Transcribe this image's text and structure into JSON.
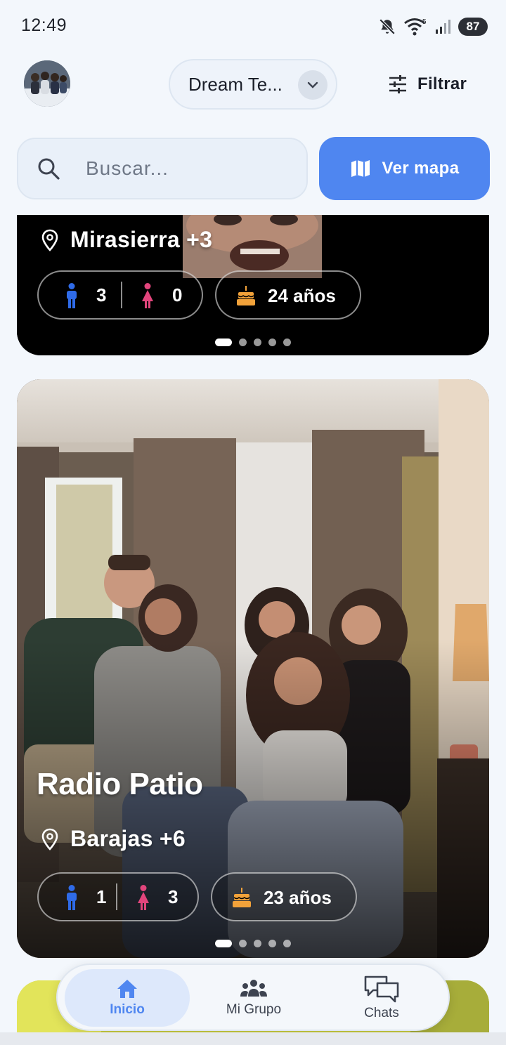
{
  "status": {
    "time": "12:49",
    "battery": "87",
    "network_tag": "5"
  },
  "header": {
    "group_name": "Dream Te...",
    "filter_label": "Filtrar"
  },
  "search": {
    "placeholder": "Buscar...",
    "map_button": "Ver mapa"
  },
  "colors": {
    "accent": "#4f86f0",
    "male_icon": "#2f6be8",
    "female_icon": "#e2457c",
    "cake_icon": "#f2a23a"
  },
  "cards": [
    {
      "location": "Mirasierra +3",
      "male_count": "3",
      "female_count": "0",
      "age": "24 años",
      "pages": 5,
      "active_page": 1
    },
    {
      "name": "Radio Patio",
      "location": "Barajas +6",
      "male_count": "1",
      "female_count": "3",
      "age": "23 años",
      "pages": 5,
      "active_page": 1
    }
  ],
  "nav": {
    "items": [
      {
        "label": "Inicio",
        "icon": "home-icon",
        "active": true
      },
      {
        "label": "Mi Grupo",
        "icon": "group-icon",
        "active": false
      },
      {
        "label": "Chats",
        "icon": "chats-icon",
        "active": false
      }
    ]
  }
}
